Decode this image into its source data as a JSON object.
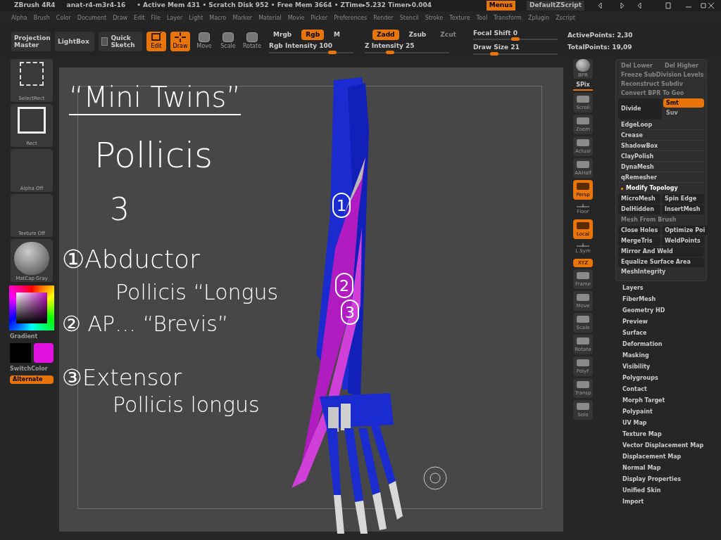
{
  "title_bar": {
    "app": "ZBrush 4R4",
    "file": "anat-r4-m3r4-16",
    "stats": "• Active Mem 431 • Scratch Disk 952 • Free Mem 3664 • ZTime▸5.232 Timer▸0.004",
    "menus_button": {
      "label": "Menus",
      "on": true
    },
    "script": "DefaultZScript"
  },
  "menu_bar": [
    "Alpha",
    "Brush",
    "Color",
    "Document",
    "Draw",
    "Edit",
    "File",
    "Layer",
    "Light",
    "Macro",
    "Marker",
    "Material",
    "Movie",
    "Picker",
    "Preferences",
    "Render",
    "Stencil",
    "Stroke",
    "Texture",
    "Tool",
    "Transform",
    "Zplugin",
    "Zscript"
  ],
  "toolbar": {
    "buttons": [
      {
        "label": "Projection Master",
        "kind": "wide"
      },
      {
        "label": "LightBox",
        "kind": "wide"
      },
      {
        "label": "Quick Sketch",
        "kind": "sketch"
      }
    ],
    "modes": [
      {
        "label": "Edit",
        "on": true,
        "kind": "edit"
      },
      {
        "label": "Draw",
        "on": true,
        "kind": "draw"
      },
      {
        "label": "Move",
        "on": false,
        "kind": "M"
      },
      {
        "label": "Scale",
        "on": false,
        "kind": "S"
      },
      {
        "label": "Rotate",
        "on": false,
        "kind": "R"
      }
    ],
    "color_modes": [
      {
        "label": "Mrgb",
        "on": false,
        "disabled": false
      },
      {
        "label": "Rgb",
        "on": true,
        "disabled": false
      },
      {
        "label": "M",
        "on": false,
        "disabled": false
      }
    ],
    "z_modes": [
      {
        "label": "Zadd",
        "on": true,
        "disabled": false
      },
      {
        "label": "Zsub",
        "on": false,
        "disabled": false
      },
      {
        "label": "Zcut",
        "on": false,
        "disabled": true
      }
    ],
    "sliders": [
      {
        "label": "Rgb Intensity 100",
        "level": 0.75
      },
      {
        "label": "Z Intensity 25",
        "level": 0.3
      },
      {
        "label": "Focal Shift 0",
        "level": 0.5
      },
      {
        "label": "Draw Size 21",
        "level": 0.25
      }
    ],
    "stats": [
      "ActivePoints: 2,30",
      "TotalPoints: 19,09"
    ]
  },
  "left_shelf": {
    "thumbs": [
      {
        "label": "SelectRect",
        "kind": "selectrect"
      },
      {
        "label": "Rect",
        "kind": "rect"
      },
      {
        "label": "Alpha Off",
        "kind": "empty"
      },
      {
        "label": "Texture Off",
        "kind": "empty"
      },
      {
        "label": "MatCap Gray",
        "kind": "sphere"
      }
    ],
    "gradient_label": "Gradient",
    "switch_label": "SwitchColor",
    "alternate": {
      "label": "Alternate",
      "on": true
    }
  },
  "canvas": {
    "annotations": [
      {
        "text": "“Mini Twins”",
        "kind": "title"
      },
      {
        "text": "Pollicis",
        "kind": "big"
      },
      {
        "text": "3",
        "kind": "big"
      },
      {
        "text": "①Abductor",
        "kind": "line"
      },
      {
        "text": "Pollicis “Longus",
        "kind": "line"
      },
      {
        "text": "②  AP… “Brevis”",
        "kind": "line"
      },
      {
        "text": "③Extensor",
        "kind": "line"
      },
      {
        "text": "Pollicis longus",
        "kind": "line"
      }
    ],
    "model_labels": [
      "1",
      "2",
      "3"
    ]
  },
  "right_shelf": [
    {
      "label": "BPR",
      "kind": "sphere",
      "on": false
    },
    {
      "label": "SPix",
      "kind": "slider",
      "on": false
    },
    {
      "label": "Scroll",
      "kind": "icon",
      "on": false
    },
    {
      "label": "Zoom",
      "kind": "icon",
      "on": false
    },
    {
      "label": "Actual",
      "kind": "icon",
      "on": false
    },
    {
      "label": "AAHalf",
      "kind": "icon",
      "on": false
    },
    {
      "label": "Persp",
      "kind": "icon",
      "on": true
    },
    {
      "label": "Floor",
      "kind": "small",
      "on": false
    },
    {
      "label": "Local",
      "kind": "icon",
      "on": true
    },
    {
      "label": "L.Sym",
      "kind": "small",
      "on": false
    },
    {
      "label": "XYZ",
      "kind": "pill",
      "on": true
    },
    {
      "label": "Frame",
      "kind": "icon",
      "on": false
    },
    {
      "label": "Move",
      "kind": "icon",
      "on": false
    },
    {
      "label": "Scale",
      "kind": "icon",
      "on": false
    },
    {
      "label": "Rotate",
      "kind": "icon",
      "on": false
    },
    {
      "label": "PolyF",
      "kind": "icon",
      "on": false
    },
    {
      "label": "Transp",
      "kind": "icon",
      "on": false
    },
    {
      "label": "Solo",
      "kind": "icon",
      "on": false
    }
  ],
  "tool_panel": {
    "faded": [
      [
        "Del Lower",
        "Del Higher"
      ],
      [
        "Freeze SubDivision Levels"
      ],
      [
        "Reconstruct Subdiv"
      ],
      [
        "Convert BPR To Geo"
      ]
    ],
    "divide": {
      "label": "Divide",
      "smt": {
        "label": "Smt",
        "on": true
      },
      "suv": {
        "label": "Suv",
        "on": false
      }
    },
    "items": [
      {
        "label": "EdgeLoop",
        "kind": "header"
      },
      {
        "label": "Crease",
        "kind": "header"
      },
      {
        "label": "ShadowBox",
        "kind": "header"
      },
      {
        "label": "ClayPolish",
        "kind": "header"
      },
      {
        "label": "DynaMesh",
        "kind": "header"
      },
      {
        "label": "qRemesher",
        "kind": "header"
      },
      {
        "label": "Modify Topology",
        "kind": "open"
      }
    ],
    "topology": [
      [
        {
          "label": "MicroMesh",
          "disabled": false
        },
        {
          "label": "Spin Edge",
          "disabled": false
        }
      ],
      [
        {
          "label": "DelHidden",
          "disabled": false
        },
        {
          "label": "InsertMesh",
          "disabled": false
        }
      ],
      [
        {
          "label": "Mesh From Brush",
          "disabled": true
        }
      ],
      [
        {
          "label": "Close Holes",
          "disabled": false
        },
        {
          "label": "Optimize Poi",
          "disabled": false
        }
      ],
      [
        {
          "label": "MergeTris",
          "disabled": false
        },
        {
          "label": "WeldPoints",
          "disabled": false
        }
      ],
      [
        {
          "label": "Mirror And Weld",
          "disabled": false
        }
      ],
      [
        {
          "label": "Equalize Surface Area",
          "disabled": false
        }
      ]
    ],
    "integrity": "MeshIntegrity",
    "sections": [
      "Layers",
      "FiberMesh",
      "Geometry HD",
      "Preview",
      "Surface",
      "Deformation",
      "Masking",
      "Visibility",
      "Polygroups",
      "Contact",
      "Morph Target",
      "Polypaint",
      "UV Map",
      "Texture Map",
      "Vector Displacement Map",
      "Displacement Map",
      "Normal Map",
      "Display Properties",
      "Unified Skin",
      "Import"
    ]
  }
}
